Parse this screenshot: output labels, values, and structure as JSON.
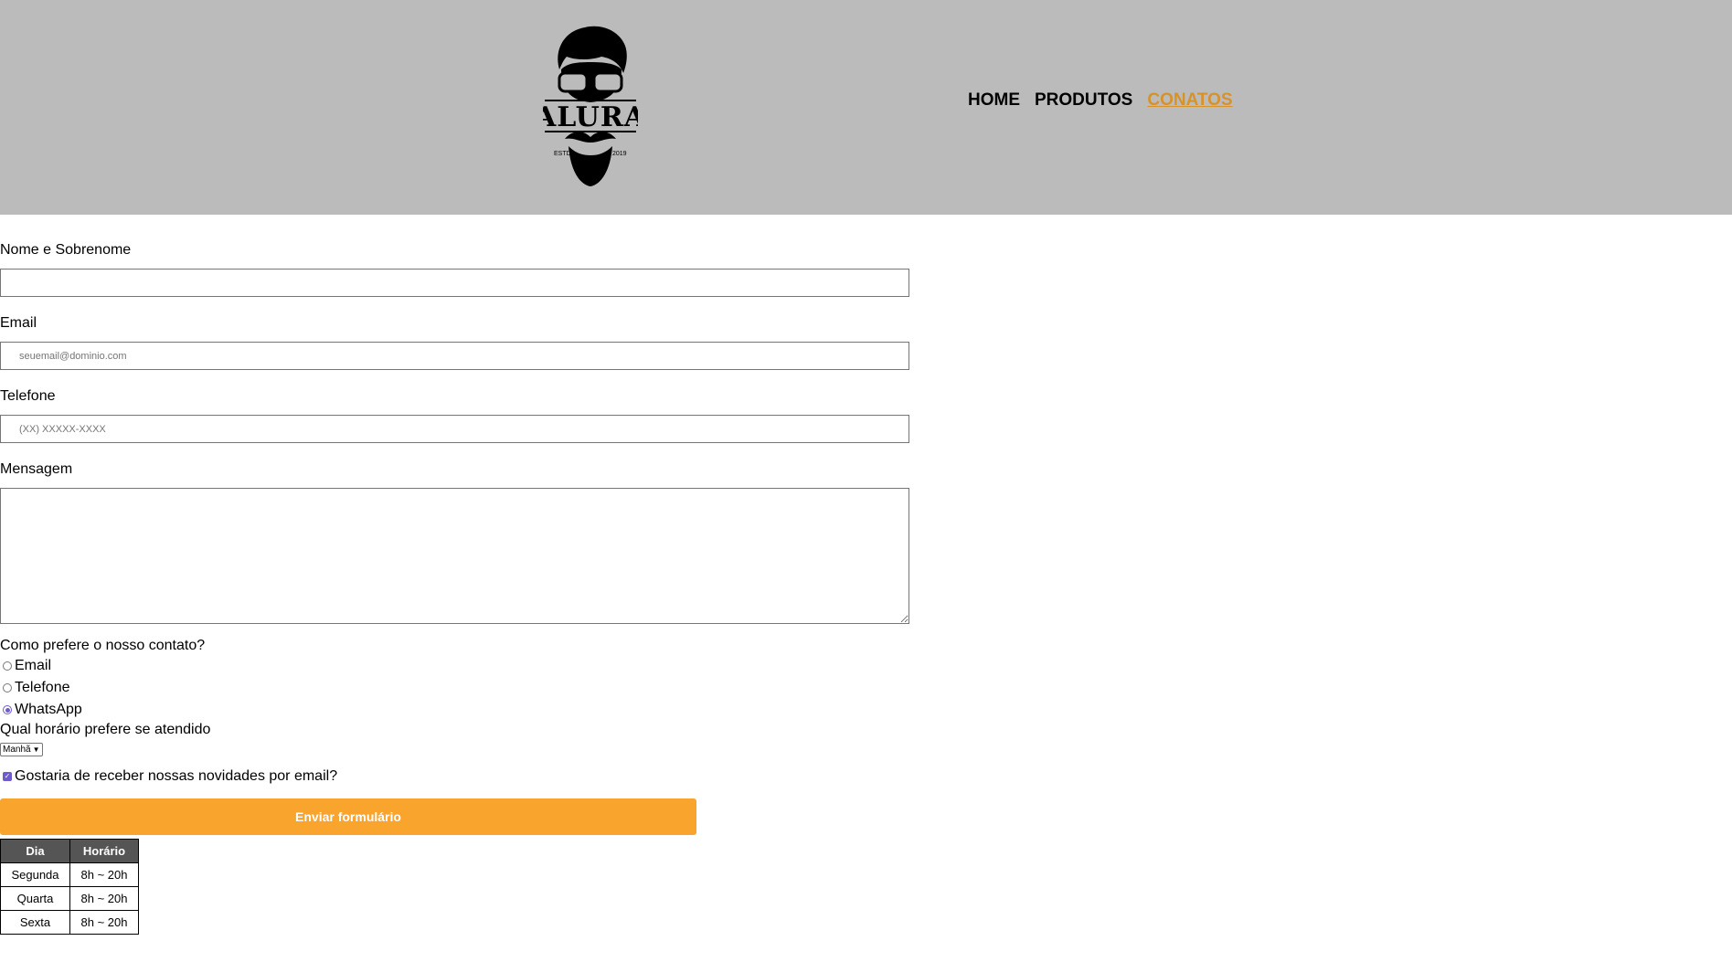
{
  "header": {
    "logo": {
      "brand": "ALURA",
      "estd": "ESTD",
      "year": "2019"
    },
    "nav": [
      {
        "label": "HOME",
        "active": false
      },
      {
        "label": "PRODUTOS",
        "active": false
      },
      {
        "label": "CONATOS",
        "active": true
      }
    ]
  },
  "form": {
    "name_label": "Nome e Sobrenome",
    "name_value": "",
    "email_label": "Email",
    "email_placeholder": "seuemail@dominio.com",
    "phone_label": "Telefone",
    "phone_placeholder": "(XX) XXXXX-XXXX",
    "message_label": "Mensagem",
    "message_value": "",
    "contact_question": "Como prefere o nosso contato?",
    "contact_options": [
      {
        "label": "Email",
        "checked": false
      },
      {
        "label": "Telefone",
        "checked": false
      },
      {
        "label": "WhatsApp",
        "checked": true
      }
    ],
    "time_question": "Qual horário prefere se atendido",
    "time_selected": "Manhã",
    "newsletter_label": "Gostaria de receber nossas novidades por email?",
    "newsletter_checked": true,
    "submit_label": "Enviar formulário"
  },
  "schedule": {
    "headers": [
      "Dia",
      "Horário"
    ],
    "rows": [
      [
        "Segunda",
        "8h ~ 20h"
      ],
      [
        "Quarta",
        "8h ~ 20h"
      ],
      [
        "Sexta",
        "8h ~ 20h"
      ]
    ]
  },
  "colors": {
    "header_bg": "#bbbbbb",
    "nav_active": "#d7922a",
    "submit_bg": "#f9a42d",
    "table_header_bg": "#555555",
    "accent": "#6f5bd0"
  }
}
